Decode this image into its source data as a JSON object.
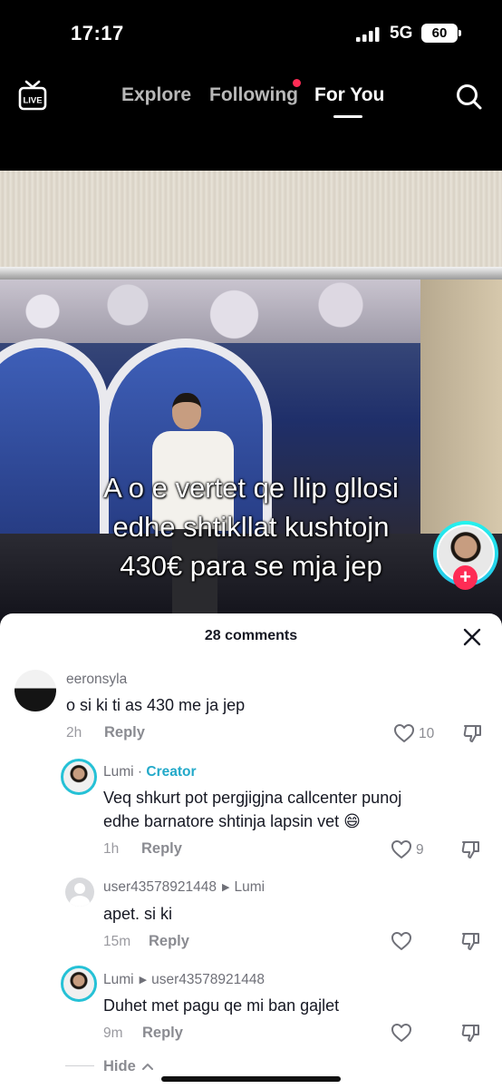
{
  "status_bar": {
    "time": "17:17",
    "network": "5G",
    "battery": "60"
  },
  "top_nav": {
    "live_label": "LIVE",
    "tabs": [
      {
        "label": "Explore",
        "active": false
      },
      {
        "label": "Following",
        "active": false,
        "notification_dot": true
      },
      {
        "label": "For You",
        "active": true
      }
    ],
    "search_icon": "search-icon"
  },
  "video": {
    "caption_lines": [
      "A o e vertet qe llip gllosi",
      "edhe shtikllat kushtojn",
      "430€ para se mja jep"
    ],
    "follow_symbol": "+"
  },
  "comments_sheet": {
    "title": "28 comments",
    "comments": [
      {
        "username": "eeronsyla",
        "text": "o si ki ti as 430 me ja jep",
        "time": "2h",
        "reply_label": "Reply",
        "likes": "10"
      },
      {
        "username": "Lumi",
        "separator": "·",
        "badge": "Creator",
        "text_line1": "Veq shkurt pot pergjigjna callcenter punoj",
        "text_line2": "edhe barnatore shtinja lapsin vet 😄",
        "time": "1h",
        "reply_label": "Reply",
        "likes": "9"
      },
      {
        "username": "user43578921448",
        "reply_to": "Lumi",
        "text": "apet. si ki",
        "time": "15m",
        "reply_label": "Reply",
        "likes": ""
      },
      {
        "username": "Lumi",
        "reply_to": "user43578921448",
        "text": "Duhet met pagu qe mi ban gajlet",
        "time": "9m",
        "reply_label": "Reply",
        "likes": ""
      }
    ],
    "hide_label": "Hide",
    "hide_icon": "chevron-up-icon"
  },
  "colors": {
    "accent_red": "#fe2c55",
    "creator_teal": "#22a9c9"
  }
}
